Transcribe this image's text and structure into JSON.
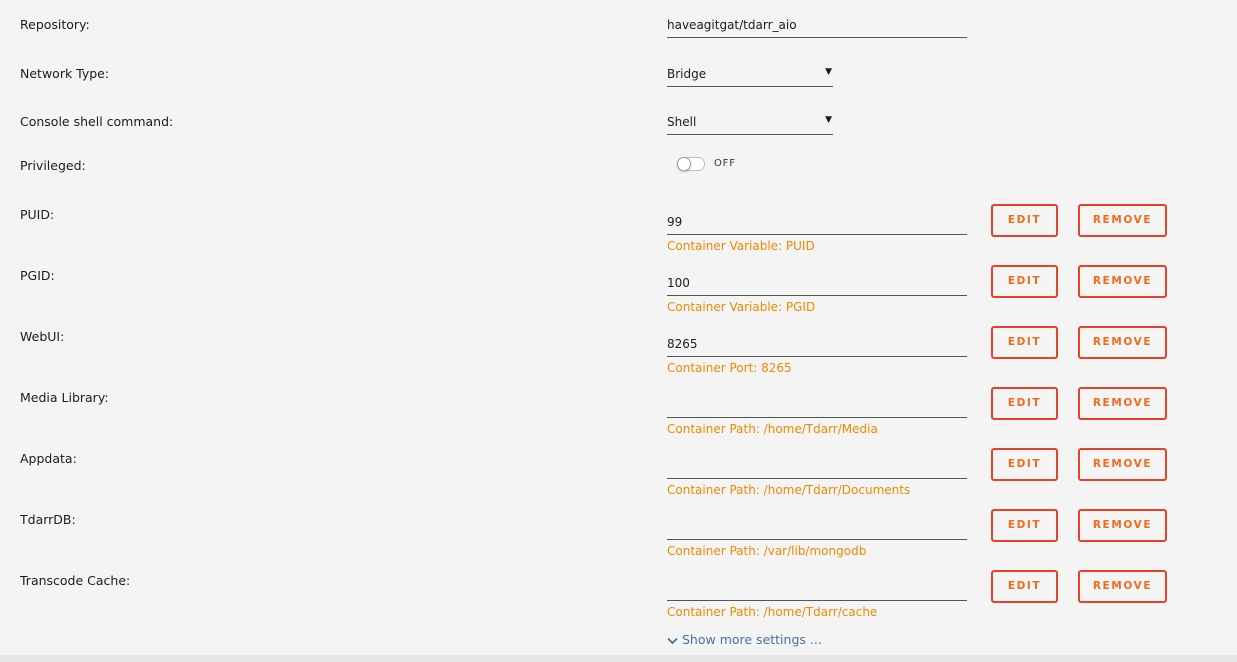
{
  "repository": {
    "label": "Repository:",
    "value": "haveagitgat/tdarr_aio"
  },
  "network_type": {
    "label": "Network Type:",
    "selected": "Bridge"
  },
  "console_shell": {
    "label": "Console shell command:",
    "selected": "Shell"
  },
  "privileged": {
    "label": "Privileged:",
    "state_label": "OFF",
    "enabled": false
  },
  "buttons": {
    "edit": "EDIT",
    "remove": "REMOVE"
  },
  "settings": [
    {
      "label": "PUID:",
      "value": "99",
      "hint": "Container Variable: PUID"
    },
    {
      "label": "PGID:",
      "value": "100",
      "hint": "Container Variable: PGID"
    },
    {
      "label": "WebUI:",
      "value": "8265",
      "hint": "Container Port: 8265"
    },
    {
      "label": "Media Library:",
      "value": "",
      "hint": "Container Path: /home/Tdarr/Media"
    },
    {
      "label": "Appdata:",
      "value": "",
      "hint": "Container Path: /home/Tdarr/Documents"
    },
    {
      "label": "TdarrDB:",
      "value": "",
      "hint": "Container Path: /var/lib/mongodb"
    },
    {
      "label": "Transcode Cache:",
      "value": "",
      "hint": "Container Path: /home/Tdarr/cache"
    }
  ],
  "show_more": {
    "label": "Show more settings ...",
    "icon": "chevron-down-icon"
  },
  "colors": {
    "accent_orange": "#ee8a00",
    "button_border": "#e2432a",
    "link_blue": "#4a6fa5"
  }
}
